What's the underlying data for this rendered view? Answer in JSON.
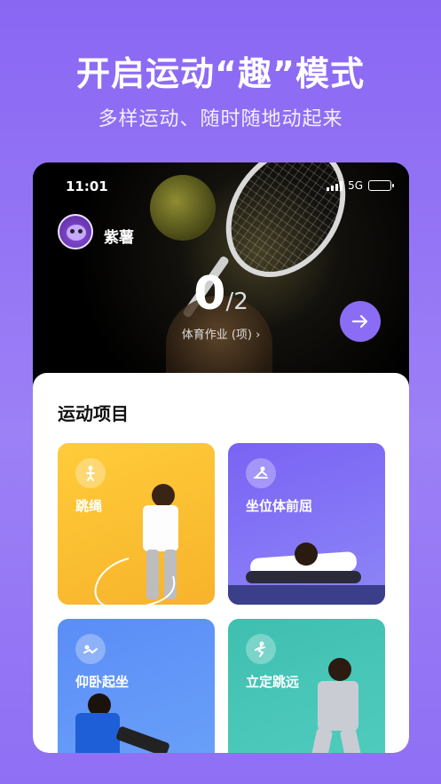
{
  "promo": {
    "title": "开启运动“趣”模式",
    "subtitle": "多样运动、随时随地动起来"
  },
  "status_bar": {
    "time": "11:01",
    "network": "5G"
  },
  "user": {
    "name": "紫薯"
  },
  "homework": {
    "done": "0",
    "total": "/2",
    "label": "体育作业 (项) ›"
  },
  "section": {
    "title": "运动项目"
  },
  "sports": [
    {
      "label": "跳绳",
      "icon": "jump-rope-icon",
      "color": "#ffcc3a"
    },
    {
      "label": "坐位体前屈",
      "icon": "sit-and-reach-icon",
      "color": "#7a63f4"
    },
    {
      "label": "仰卧起坐",
      "icon": "sit-up-icon",
      "color": "#5b8df7"
    },
    {
      "label": "立定跳远",
      "icon": "long-jump-icon",
      "color": "#3fbfb0"
    }
  ],
  "colors": {
    "background": "#8a67f3",
    "accent": "#8b6cf5"
  }
}
